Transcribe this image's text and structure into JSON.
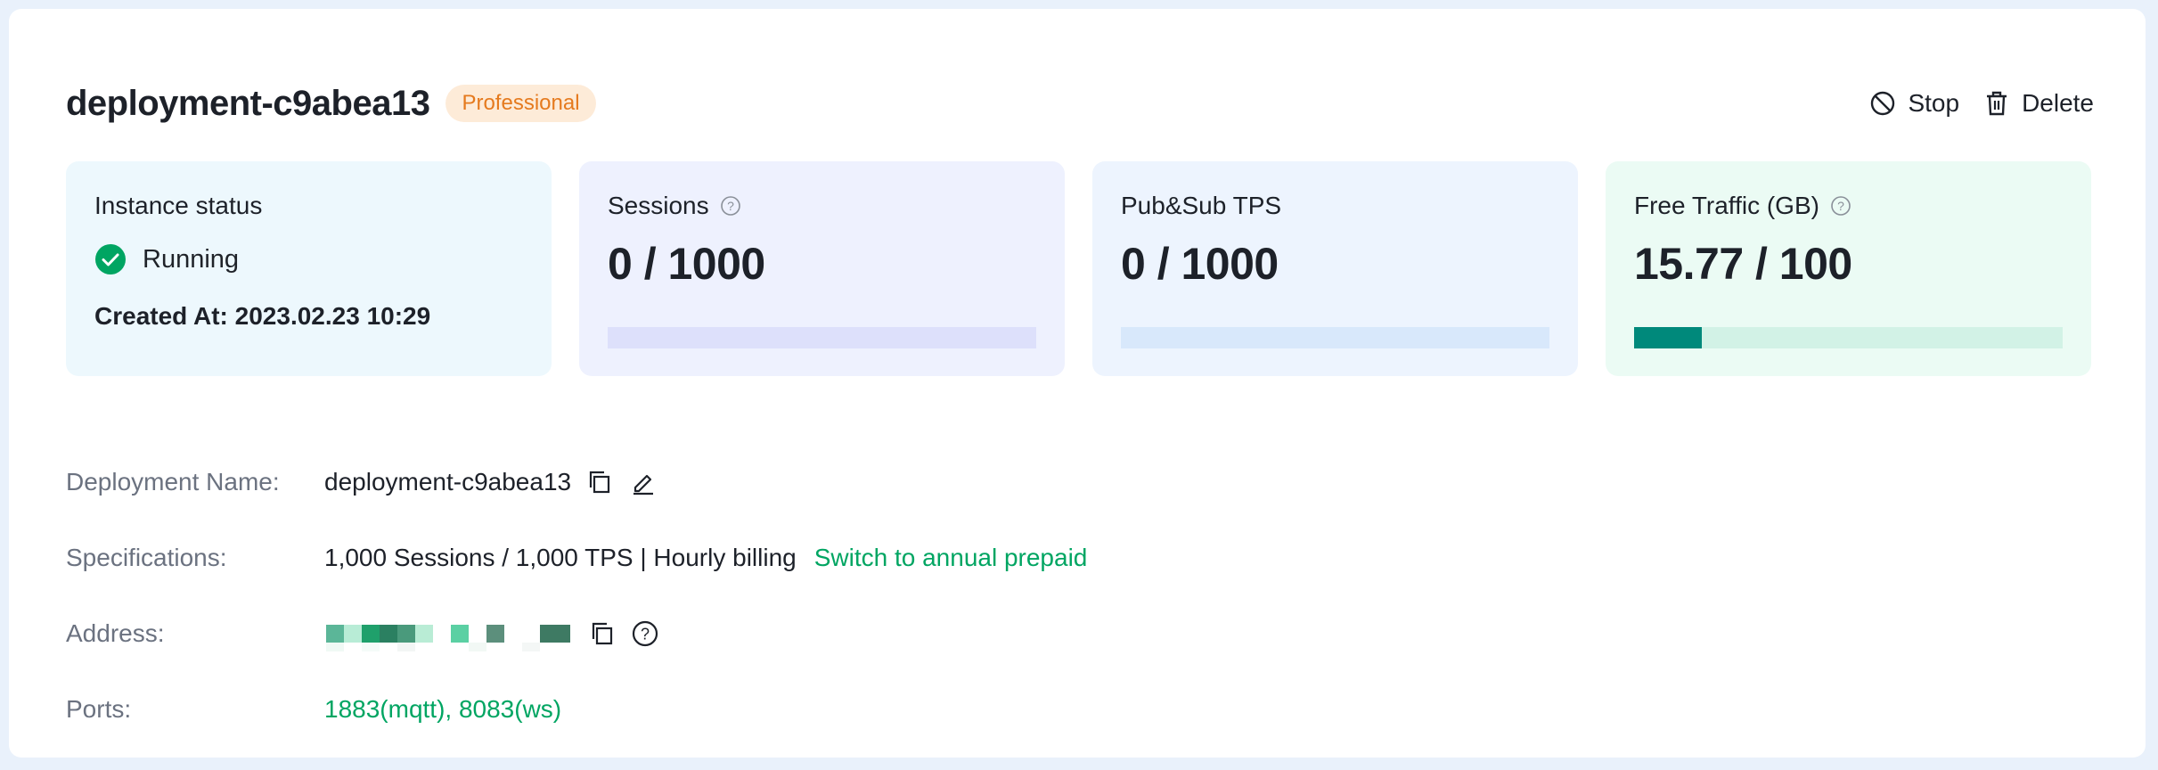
{
  "header": {
    "title": "deployment-c9abea13",
    "badge": "Professional",
    "stop_label": "Stop",
    "delete_label": "Delete"
  },
  "cards": {
    "status": {
      "label": "Instance status",
      "state": "Running",
      "created": "Created At: 2023.02.23 10:29"
    },
    "sessions": {
      "label": "Sessions",
      "value": "0 / 1000",
      "fraction": 0.0
    },
    "tps": {
      "label": "Pub&Sub TPS",
      "value": "0 / 1000",
      "fraction": 0.0
    },
    "traffic": {
      "label": "Free Traffic (GB)",
      "value": "15.77 / 100",
      "fraction": 0.1577
    }
  },
  "details": {
    "name_label": "Deployment Name:",
    "name_value": "deployment-c9abea13",
    "spec_label": "Specifications:",
    "spec_value": "1,000 Sessions / 1,000 TPS | Hourly billing",
    "spec_link": "Switch to annual prepaid",
    "address_label": "Address:",
    "ports_label": "Ports:",
    "ports_value": "1883(mqtt), 8083(ws)"
  },
  "colors": {
    "accent_green": "#00a562",
    "badge_bg": "#fdebd8",
    "badge_text": "#e57a1e",
    "progress_fill": "#00897b"
  },
  "icons": [
    "stop-icon",
    "trash-icon",
    "check-circle-icon",
    "help-icon",
    "copy-icon",
    "edit-icon"
  ]
}
